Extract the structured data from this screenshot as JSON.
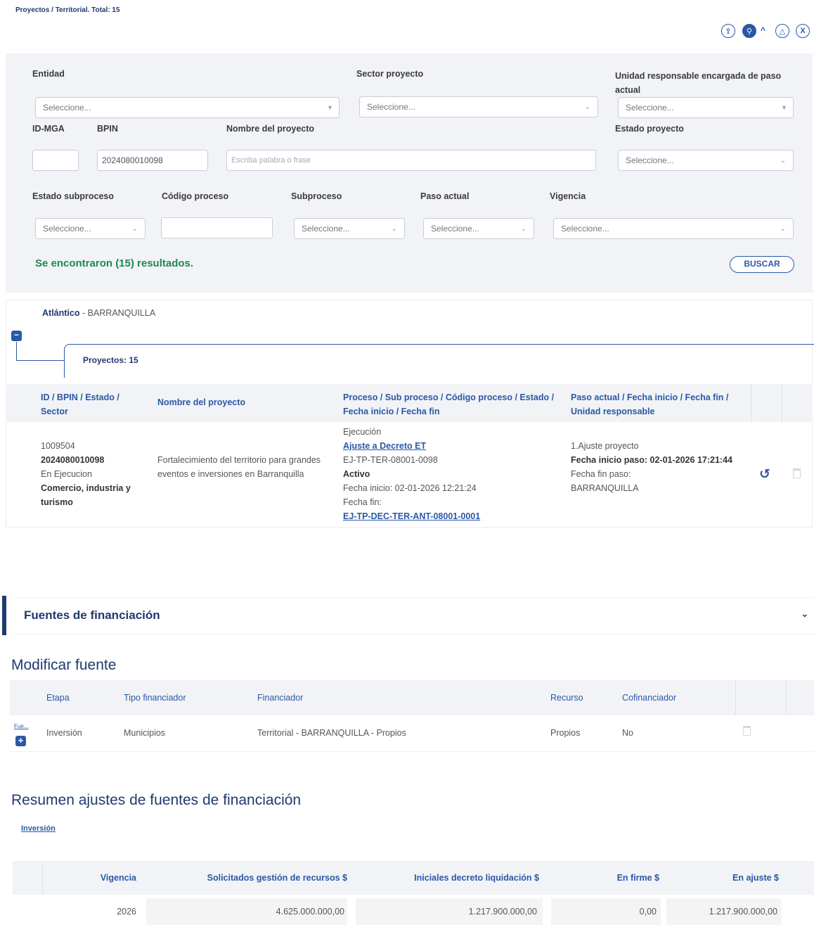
{
  "breadcrumb": "Proyectos / Territorial. Total: 15",
  "toolbar_icons": [
    "upload-icon",
    "search-icon",
    "chevron-up-icon",
    "pdf-icon",
    "excel-icon"
  ],
  "filters": {
    "entidad_label": "Entidad",
    "entidad_value": "Seleccione...",
    "sector_label": "Sector proyecto",
    "sector_value": "Seleccione...",
    "unidad_label": "Unidad responsable encargada de paso actual",
    "unidad_value": "Seleccione...",
    "idmga_label": "ID-MGA",
    "idmga_value": "",
    "bpin_label": "BPIN",
    "bpin_value": "2024080010098",
    "nombre_label": "Nombre del proyecto",
    "nombre_placeholder": "Escriba palabra o frase",
    "estado_proyecto_label": "Estado proyecto",
    "estado_proyecto_value": "Seleccione...",
    "estado_subproceso_label": "Estado subproceso",
    "estado_subproceso_value": "Seleccione...",
    "codigo_proceso_label": "Código proceso",
    "codigo_proceso_value": "",
    "subproceso_label": "Subproceso",
    "subproceso_value": "Seleccione...",
    "paso_actual_label": "Paso actual",
    "paso_actual_value": "Seleccione...",
    "vigencia_label": "Vigencia",
    "vigencia_value": "Seleccione...",
    "results_text": "Se encontraron (15) resultados.",
    "search_button": "BUSCAR"
  },
  "group": {
    "department": "Atlántico",
    "separator": " - ",
    "city": "BARRANQUILLA",
    "projects_label": "Proyectos: 15"
  },
  "projects_table": {
    "headers": [
      "ID / BPIN / Estado / Sector",
      "Nombre del proyecto",
      "Proceso / Sub proceso / Código proceso / Estado / Fecha inicio / Fecha fin",
      "Paso actual / Fecha inicio / Fecha fin / Unidad responsable"
    ],
    "row": {
      "id": "1009504",
      "bpin": "2024080010098",
      "estado": "En Ejecucion",
      "sector": "Comercio, industria y turismo",
      "nombre": "Fortalecimiento del territorio para grandes eventos e inversiones en Barranquilla",
      "proceso": "Ejecución",
      "subproceso": "Ajuste a Decreto ET",
      "codigo": "EJ-TP-TER-08001-0098",
      "estado_proceso": "Activo",
      "fecha_inicio": "Fecha inicio: 02-01-2026 12:21:24",
      "fecha_fin": "Fecha fin:",
      "link_codigo": "EJ-TP-DEC-TER-ANT-08001-0001",
      "paso": "1.Ajuste proyecto",
      "paso_inicio": "Fecha inicio paso: 02-01-2026 17:21:44",
      "paso_fin": "Fecha fin paso:",
      "unidad": "BARRANQUILLA"
    }
  },
  "fuentes_section": {
    "title": "Fuentes de financiación"
  },
  "modificar": {
    "title": "Modificar fuente",
    "headers": [
      "Etapa",
      "Tipo financiador",
      "Financiador",
      "Recurso",
      "Cofinanciador"
    ],
    "row": {
      "link": "Fue...",
      "etapa": "Inversión",
      "tipo": "Municipios",
      "financiador": "Territorial - BARRANQUILLA - Propios",
      "recurso": "Propios",
      "cofinanciador": "No"
    }
  },
  "resumen": {
    "title": "Resumen ajustes de fuentes de financiación",
    "tab": "Inversión",
    "headers": [
      "Vigencia",
      "Solicitados gestión de recursos $",
      "Iniciales decreto liquidación $",
      "En firme $",
      "En ajuste $"
    ],
    "row": [
      "2026",
      "4.625.000.000,00",
      "1.217.900.000,00",
      "0,00",
      "1.217.900.000,00"
    ]
  }
}
